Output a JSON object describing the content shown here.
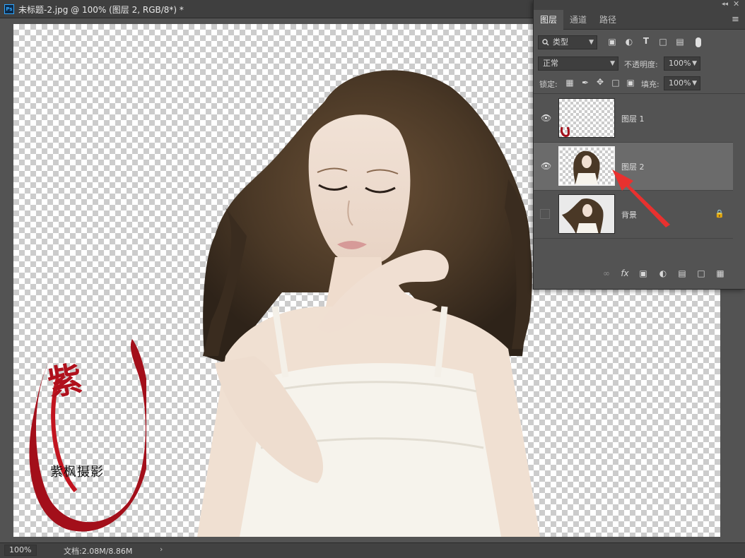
{
  "document": {
    "title": "未标题-2.jpg @ 100% (图层 2, RGB/8*) *",
    "app_badge": "Ps"
  },
  "status_bar": {
    "zoom": "100%",
    "doc_info": "文档:2.08M/8.86M",
    "arrow": "›"
  },
  "watermark": {
    "glyph": "紫",
    "text": "紫枫摄影"
  },
  "layers_panel": {
    "window_icons": {
      "collapse": "◂◂",
      "close": "✕"
    },
    "tabs": [
      {
        "label": "图层",
        "active": true
      },
      {
        "label": "通道",
        "active": false
      },
      {
        "label": "路径",
        "active": false
      }
    ],
    "menu_icon": "≡",
    "filter": {
      "kind_value": "类型",
      "icons": [
        "image-filter-icon",
        "adjustment-filter-icon",
        "type-filter-icon",
        "shape-filter-icon",
        "smart-object-filter-icon"
      ]
    },
    "blend_mode": "正常",
    "opacity_label": "不透明度:",
    "opacity_value": "100%",
    "lock_label": "锁定:",
    "fill_label": "填充:",
    "fill_value": "100%",
    "layers": [
      {
        "name": "图层 1",
        "visible": true,
        "selected": false,
        "locked": false
      },
      {
        "name": "图层 2",
        "visible": true,
        "selected": true,
        "locked": false
      },
      {
        "name": "背景",
        "visible": false,
        "selected": false,
        "locked": true
      }
    ],
    "footer_icons": [
      "link-layers-icon",
      "fx-icon",
      "add-mask-icon",
      "adjustment-layer-icon",
      "new-group-icon",
      "new-layer-icon",
      "delete-layer-icon"
    ]
  },
  "colors": {
    "accent_red": "#e8312f",
    "watermark_red": "#b0101c",
    "panel_bg": "#535353",
    "selected_row": "#6b6b6b"
  }
}
